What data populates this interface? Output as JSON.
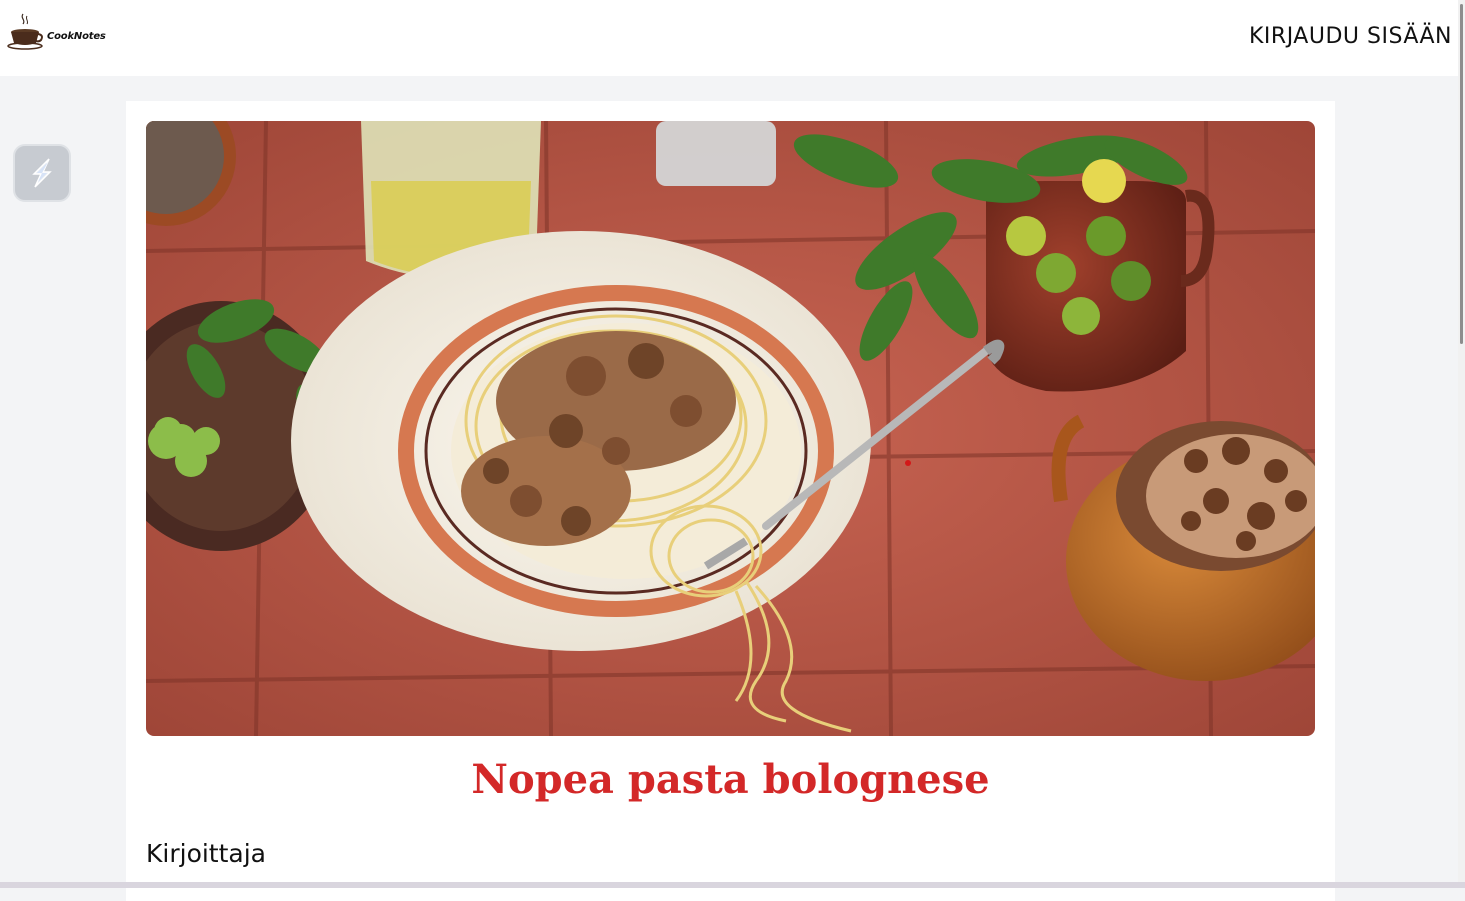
{
  "header": {
    "logo_text": "CookNotes",
    "login_label": "KIRJAUDU SISÄÄN"
  },
  "side_widget": {
    "icon": "s-logo-icon"
  },
  "recipe": {
    "hero_image": "pasta-bolognese-photo",
    "title": "Nopea pasta bolognese",
    "author_label": "Kirjoittaja"
  },
  "colors": {
    "title": "#d32828",
    "page_bg": "#f3f4f6",
    "card_bg": "#ffffff",
    "tiles": "#b65446"
  }
}
